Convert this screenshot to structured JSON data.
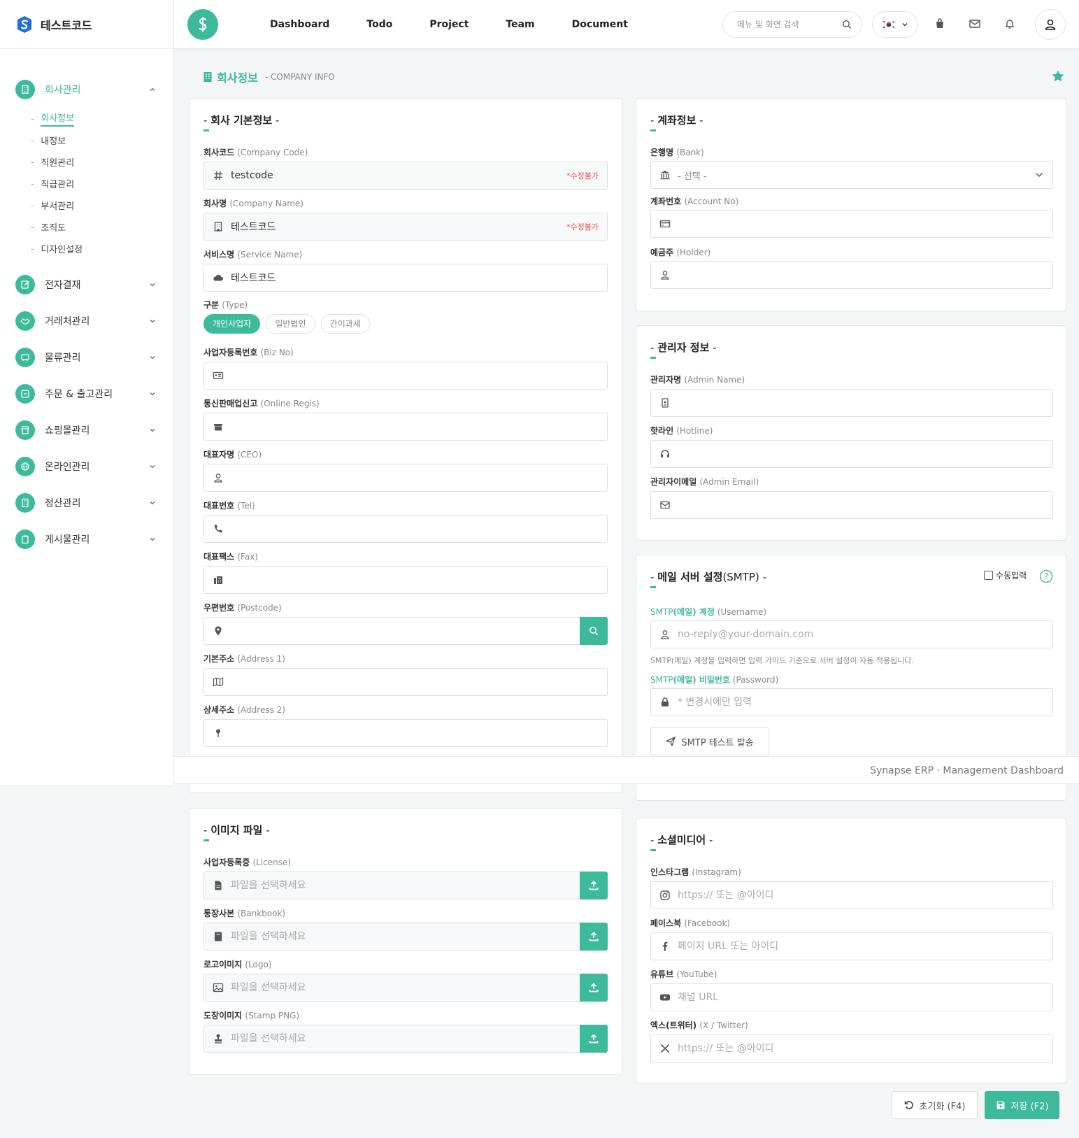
{
  "brand": {
    "name": "테스트코드"
  },
  "colors": {
    "accent": "#3dba9a",
    "warning": "#e55353"
  },
  "sidebar": {
    "items": [
      {
        "label": "회사관리",
        "icon": "building-icon",
        "expanded": true,
        "sub": [
          {
            "label": "회사정보",
            "active": true
          },
          {
            "label": "내정보"
          },
          {
            "label": "직원관리"
          },
          {
            "label": "직급관리"
          },
          {
            "label": "부서관리"
          },
          {
            "label": "조직도"
          },
          {
            "label": "디자인설정"
          }
        ]
      },
      {
        "label": "전자결재",
        "icon": "approval-icon"
      },
      {
        "label": "거래처관리",
        "icon": "handshake-icon"
      },
      {
        "label": "물류관리",
        "icon": "truck-icon"
      },
      {
        "label": "주문 & 출고관리",
        "icon": "order-icon"
      },
      {
        "label": "쇼핑몰관리",
        "icon": "shop-icon"
      },
      {
        "label": "온라인관리",
        "icon": "globe-icon"
      },
      {
        "label": "정산관리",
        "icon": "calculator-icon"
      },
      {
        "label": "게시물관리",
        "icon": "clipboard-icon"
      }
    ],
    "dash": "-"
  },
  "header": {
    "nav": [
      "Dashboard",
      "Todo",
      "Project",
      "Team",
      "Document"
    ],
    "search_placeholder": "메뉴 및 화면 검색",
    "language": "ko"
  },
  "page": {
    "title": "회사정보",
    "subtitle": "- COMPANY INFO"
  },
  "basic": {
    "title_pre": "- ",
    "title": "회사 기본정보",
    "title_post": " -",
    "company_code_label": "회사코드",
    "company_code_en": "(Company Code)",
    "company_code_value": "testcode",
    "readonly_tag": "*수정불가",
    "company_name_label": "회사명",
    "company_name_en": "(Company Name)",
    "company_name_value": "테스트코드",
    "service_name_label": "서비스명",
    "service_name_en": "(Service Name)",
    "service_name_value": "테스트코드",
    "type_label": "구분",
    "type_en": "(Type)",
    "types": [
      "개인사업자",
      "일반법인",
      "간이과세"
    ],
    "type_selected": 0,
    "biz_no_label": "사업자등록번호",
    "biz_no_en": "(Biz No)",
    "online_label": "통신판매업신고",
    "online_en": "(Online Regis)",
    "ceo_label": "대표자명",
    "ceo_en": "(CEO)",
    "tel_label": "대표번호",
    "tel_en": "(Tel)",
    "fax_label": "대표팩스",
    "fax_en": "(Fax)",
    "postcode_label": "우편번호",
    "postcode_en": "(Postcode)",
    "addr1_label": "기본주소",
    "addr1_en": "(Address 1)",
    "addr2_label": "상세주소",
    "addr2_en": "(Address 2)"
  },
  "bank": {
    "title": "계좌정보",
    "bank_label": "은행명",
    "bank_en": "(Bank)",
    "bank_placeholder": "- 선택 -",
    "account_label": "계좌번호",
    "account_en": "(Account No)",
    "holder_label": "예금주",
    "holder_en": "(Holder)"
  },
  "admin": {
    "title": "관리자 정보",
    "name_label": "관리자명",
    "name_en": "(Admin Name)",
    "hotline_label": "핫라인",
    "hotline_en": "(Hotline)",
    "email_label": "관리자이메일",
    "email_en": "(Admin Email)"
  },
  "smtp": {
    "title_bold": "메일 서버 설정",
    "title_light": "(SMTP)",
    "manual_label": "수동입력",
    "manual_checked": false,
    "user_label_pre": "SMTP",
    "user_label_bold": "(메일) 계정",
    "user_en": "(Username)",
    "user_placeholder": "no-reply@your-domain.com",
    "hint": "SMTP(메일) 계정을 입력하면 입력 가이드 기준으로 서버 설정이 자동 적용됩니다.",
    "pw_label_pre": "SMTP",
    "pw_label_bold": "(메일) 비밀번호",
    "pw_en": "(Password)",
    "pw_placeholder": "* 변경시에만 입력",
    "test_button": "SMTP 테스트 발송"
  },
  "footer": {
    "text": "Synapse ERP · Management Dashboard"
  },
  "images": {
    "title": "이미지 파일",
    "file_placeholder": "파일을 선택하세요",
    "license_label": "사업자등록증",
    "license_en": "(License)",
    "bankbook_label": "통장사본",
    "bankbook_en": "(Bankbook)",
    "logo_label": "로고이미지",
    "logo_en": "(Logo)",
    "stamp_label": "도장이미지",
    "stamp_en": "(Stamp PNG)"
  },
  "social": {
    "title": "소셜미디어",
    "instagram_label": "인스타그램",
    "instagram_en": "(Instagram)",
    "instagram_placeholder": "https:// 또는 @아이디",
    "facebook_label": "페이스북",
    "facebook_en": "(Facebook)",
    "facebook_placeholder": "페이지 URL 또는 아이디",
    "youtube_label": "유튜브",
    "youtube_en": "(YouTube)",
    "youtube_placeholder": "채널 URL",
    "x_label": "엑스(트위터)",
    "x_en": "(X / Twitter)",
    "x_placeholder": "https:// 또는 @아이디"
  },
  "actions": {
    "reset": "초기화 (F4)",
    "save": "저장 (F2)"
  }
}
